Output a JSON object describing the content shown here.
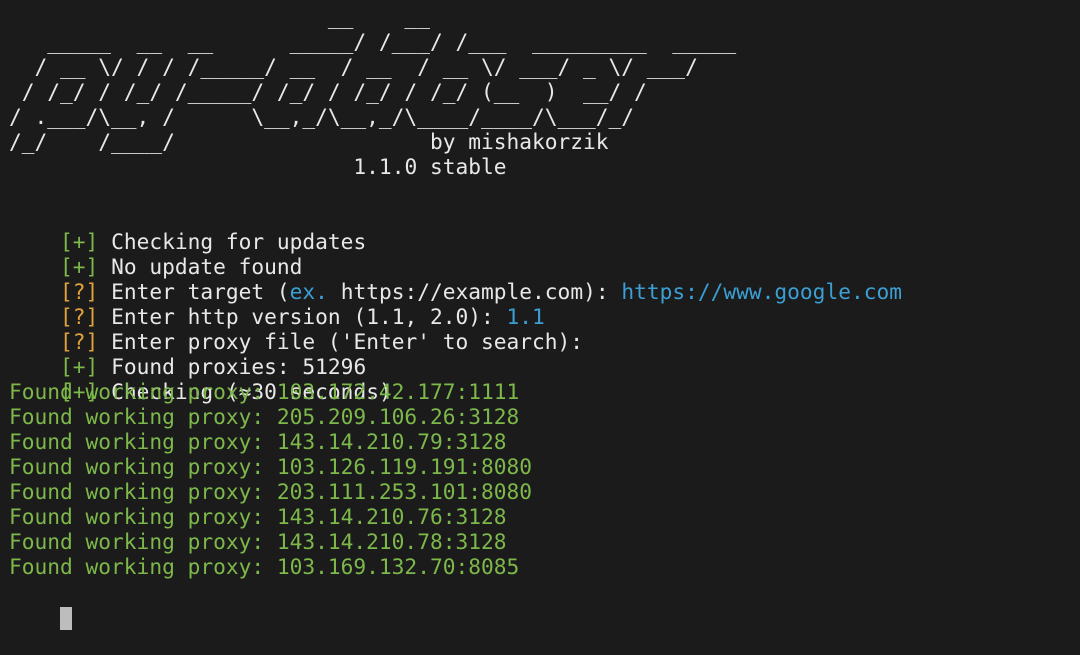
{
  "banner": {
    "art": [
      "                         __    __",
      "   _____  __  __      _____/ /___/ /___  _________  _____",
      "  / __ \\/ / / /_____/ __  / __  / __ \\/ ___/ _ \\/ ___/",
      " / /_/ / /_/ /_____/ /_/ / /_/ / /_/ (__  )  __/ /",
      "/ .___/\\__, /      \\__,_/\\__,_/\\____/____/\\___/_/",
      "/_/    /____/"
    ],
    "author": "by mishakorzik",
    "version": "1.1.0 stable"
  },
  "log": [
    {
      "tag": "[+]",
      "tag_color": "green",
      "text": "Checking for updates"
    },
    {
      "tag": "[+]",
      "tag_color": "green",
      "text": "No update found"
    },
    {
      "tag": "[?]",
      "tag_color": "orange",
      "text": "Enter target (",
      "hint": "ex.",
      "text2": " https://example.com): ",
      "input": "https://www.google.com"
    },
    {
      "tag": "[?]",
      "tag_color": "orange",
      "text": "Enter http version (1.1, 2.0): ",
      "input": "1.1"
    },
    {
      "tag": "[?]",
      "tag_color": "orange",
      "text": "Enter proxy file ('Enter' to search):"
    },
    {
      "tag": "[+]",
      "tag_color": "green",
      "text": "Found proxies: 51296"
    },
    {
      "tag": "[+]",
      "tag_color": "green",
      "text": "Checking (≈30 seconds)"
    }
  ],
  "proxies": [
    "Found working proxy: 103.172.42.177:1111",
    "Found working proxy: 205.209.106.26:3128",
    "Found working proxy: 143.14.210.79:3128",
    "Found working proxy: 103.126.119.191:8080",
    "Found working proxy: 203.111.253.101:8080",
    "Found working proxy: 143.14.210.76:3128",
    "Found working proxy: 143.14.210.78:3128",
    "Found working proxy: 103.169.132.70:8085"
  ],
  "colors": {
    "background": "#1b1b1b",
    "text": "#e8e8e8",
    "success": "#7db84a",
    "prompt": "#e0a23a",
    "input": "#3b9fd4"
  }
}
